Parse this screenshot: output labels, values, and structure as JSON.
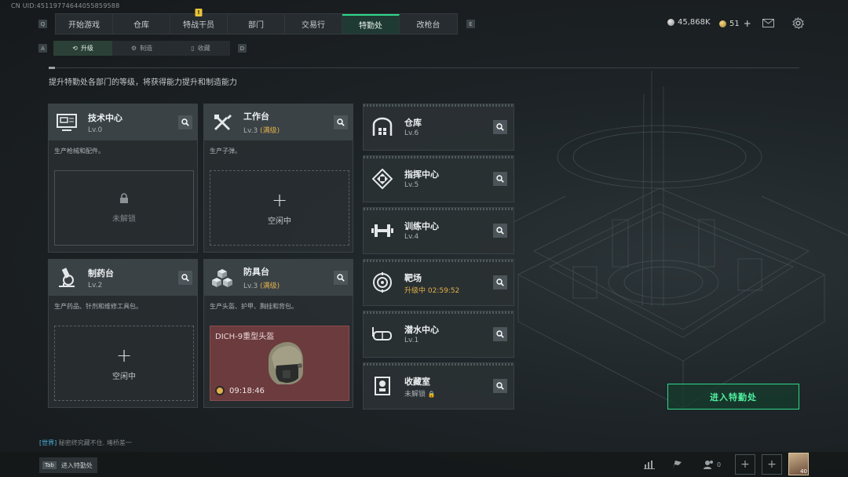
{
  "uid": "CN UID:451197746440558595​88",
  "nav": {
    "left_key": "Q",
    "right_key": "E",
    "tabs": [
      {
        "label": "开始游戏",
        "badge": ""
      },
      {
        "label": "仓库",
        "badge": ""
      },
      {
        "label": "特战干员",
        "badge": "!"
      },
      {
        "label": "部门",
        "badge": ""
      },
      {
        "label": "交易行",
        "badge": ""
      },
      {
        "label": "特勤处",
        "badge": "",
        "active": true
      },
      {
        "label": "改枪台",
        "badge": ""
      }
    ]
  },
  "currency": {
    "coins": "45,868K",
    "points": "51",
    "plus": "+"
  },
  "subnav": {
    "left_key": "A",
    "right_key": "D",
    "tabs": [
      {
        "label": "升级",
        "active": true
      },
      {
        "label": "制造"
      },
      {
        "label": "收藏"
      }
    ]
  },
  "description": "提升特勤处各部门的等级，将获得能力提升和制造能力",
  "cards": [
    {
      "name": "技术中心",
      "level": "Lv.0",
      "max": "",
      "desc": "生产枪械和配件。",
      "slot_state": "locked",
      "slot_text": "未解锁"
    },
    {
      "name": "工作台",
      "level": "Lv.3",
      "max": "(满级)",
      "desc": "生产子弹。",
      "slot_state": "idle",
      "slot_text": "空闲中"
    },
    {
      "name": "制药台",
      "level": "Lv.2",
      "max": "",
      "desc": "生产药品、针剂和维修工具包。",
      "slot_state": "idle",
      "slot_text": "空闲中"
    },
    {
      "name": "防具台",
      "level": "Lv.3",
      "max": "(满级)",
      "desc": "生产头盔、护甲、胸挂和背包。",
      "slot_state": "crafting",
      "item_name": "DICH-9重型头盔",
      "timer": "09:18:46"
    }
  ],
  "small_cards": [
    {
      "name": "仓库",
      "level": "Lv.6"
    },
    {
      "name": "指挥中心",
      "level": "Lv.5"
    },
    {
      "name": "训练中心",
      "level": "Lv.4"
    },
    {
      "name": "靶场",
      "level": "升级中 02:59:52",
      "upgrading": true
    },
    {
      "name": "潜水中心",
      "level": "Lv.1"
    },
    {
      "name": "收藏室",
      "level": "未解锁"
    }
  ],
  "enter_button": "进入特勤处",
  "chat": {
    "channel": "[世界]",
    "message": "秘密终究藏不住. 堵桥差一"
  },
  "tab_hint": {
    "key": "Tab",
    "label": "进入特勤处"
  },
  "friends_count": "0",
  "avatar_level": "40"
}
